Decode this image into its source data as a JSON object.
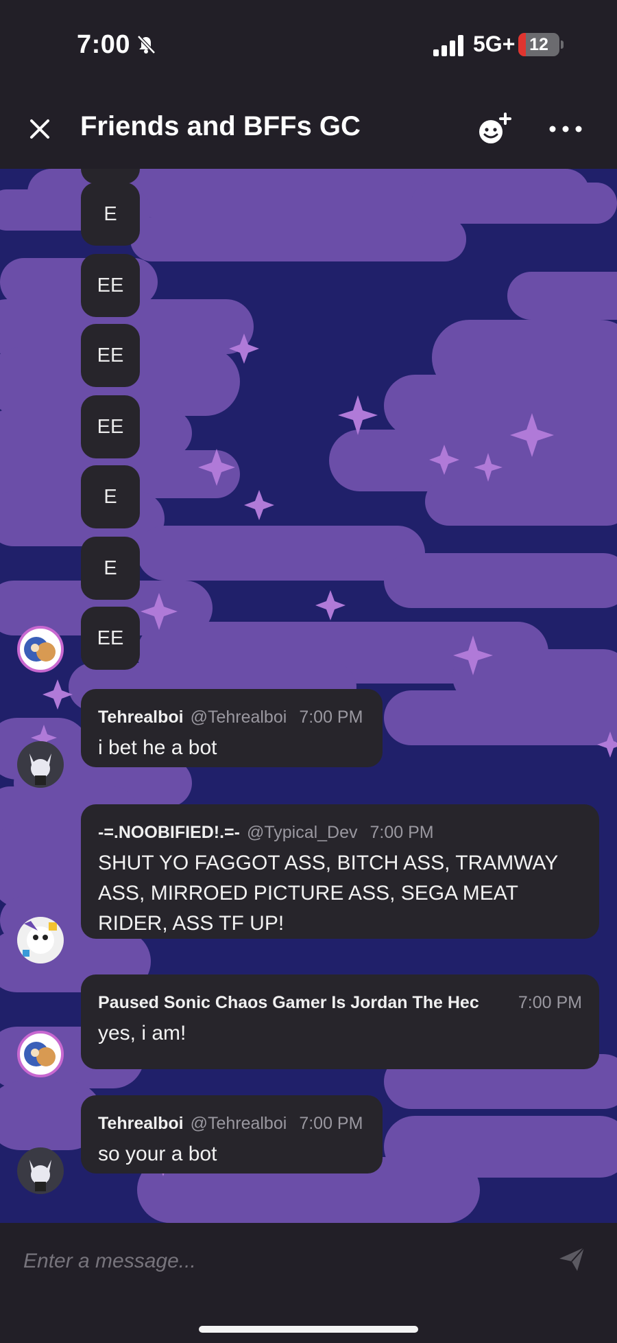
{
  "status_bar": {
    "time": "7:00",
    "network": "5G+",
    "battery": "12",
    "battery_level": 0.12,
    "icons": [
      "bell-muted-icon",
      "signal-icon",
      "battery-icon"
    ]
  },
  "header": {
    "title": "Friends and BFFs GC",
    "icons": [
      "close-icon",
      "add-friend-icon",
      "more-icon"
    ]
  },
  "mini_messages": [
    "E",
    "EE",
    "EE",
    "EE",
    "E",
    "E",
    "EE"
  ],
  "messages": [
    {
      "author": "Tehrealboi",
      "handle": "@Tehrealboi",
      "time": "7:00 PM",
      "text": "i bet he a bot"
    },
    {
      "author": "-=.NOOBIFIED!.=-",
      "handle": "@Typical_Dev",
      "time": "7:00 PM",
      "text": "SHUT YO FAGGOT ASS, BITCH ASS, TRAMWAY ASS, MIRROED PICTURE ASS, SEGA MEAT RIDER, ASS TF UP!"
    },
    {
      "author": "Paused Sonic Chaos Gamer Is Jordan The Hec",
      "handle": "",
      "time": "7:00 PM",
      "text": "yes, i am!"
    },
    {
      "author": "Tehrealboi",
      "handle": "@Tehrealboi",
      "time": "7:00 PM",
      "text": "so your a bot"
    }
  ],
  "composer": {
    "placeholder": "Enter a message...",
    "send_icon": "send-icon"
  },
  "colors": {
    "background_dark": "#221f27",
    "bubble": "#27252b",
    "chat_navy": "#20206a",
    "cloud_purple": "#6b4ea8",
    "star": "#b07ad8",
    "battery_low": "#e0342f"
  }
}
